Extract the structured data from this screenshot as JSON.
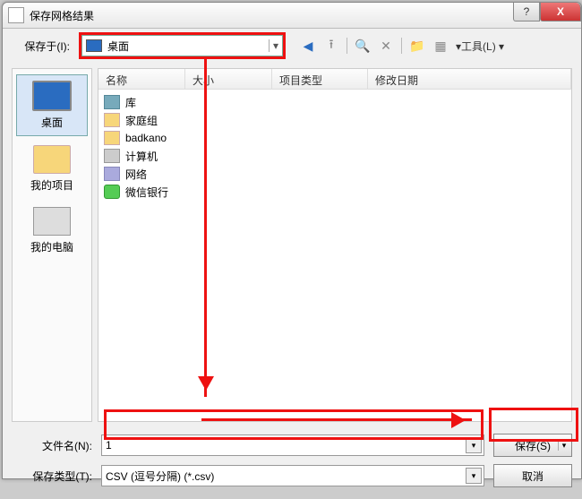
{
  "window": {
    "title": "保存网格结果",
    "help": "?",
    "close": "X"
  },
  "toolbar": {
    "saveInLabel": "保存于(I):",
    "location": "桌面",
    "toolsLabel": "工具(L)"
  },
  "places": [
    {
      "label": "桌面",
      "kind": "desktop",
      "selected": true
    },
    {
      "label": "我的项目",
      "kind": "folder",
      "selected": false
    },
    {
      "label": "我的电脑",
      "kind": "pc",
      "selected": false
    }
  ],
  "columns": {
    "name": "名称",
    "size": "大小",
    "type": "项目类型",
    "date": "修改日期"
  },
  "files": [
    {
      "label": "库",
      "kind": "lib"
    },
    {
      "label": "家庭组",
      "kind": "grp"
    },
    {
      "label": "badkano",
      "kind": "usr"
    },
    {
      "label": "计算机",
      "kind": "cmp"
    },
    {
      "label": "网络",
      "kind": "net"
    },
    {
      "label": "微信银行",
      "kind": "wx"
    }
  ],
  "bottom": {
    "fileNameLabel": "文件名(N):",
    "fileNameValue": "1",
    "fileTypeLabel": "保存类型(T):",
    "fileTypeValue": "CSV (逗号分隔) (*.csv)",
    "saveLabel": "保存(S)",
    "cancelLabel": "取消"
  }
}
